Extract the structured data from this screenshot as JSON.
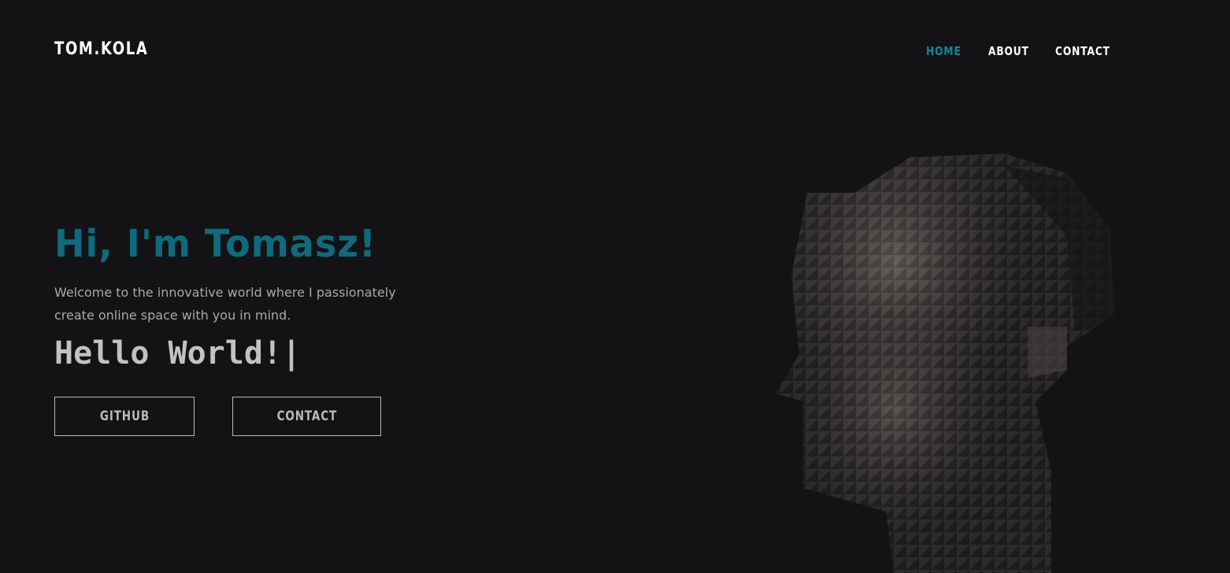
{
  "header": {
    "logo": "TOM.KOLA",
    "nav": [
      {
        "label": "HOME",
        "active": true
      },
      {
        "label": "ABOUT",
        "active": false
      },
      {
        "label": "CONTACT",
        "active": false
      }
    ]
  },
  "hero": {
    "title": "Hi, I'm Tomasz!",
    "description": "Welcome to the innovative world where I passionately create online space with you in mind.",
    "typed_text": "Hello World!",
    "cursor": "|",
    "buttons": {
      "github": "GITHUB",
      "contact": "CONTACT"
    }
  },
  "colors": {
    "background": "#131315",
    "accent": "#0f6a7d",
    "nav_active": "#17879a",
    "text_muted": "#a9a9ab"
  },
  "icons": {
    "portrait": "low-poly-portrait-image"
  }
}
